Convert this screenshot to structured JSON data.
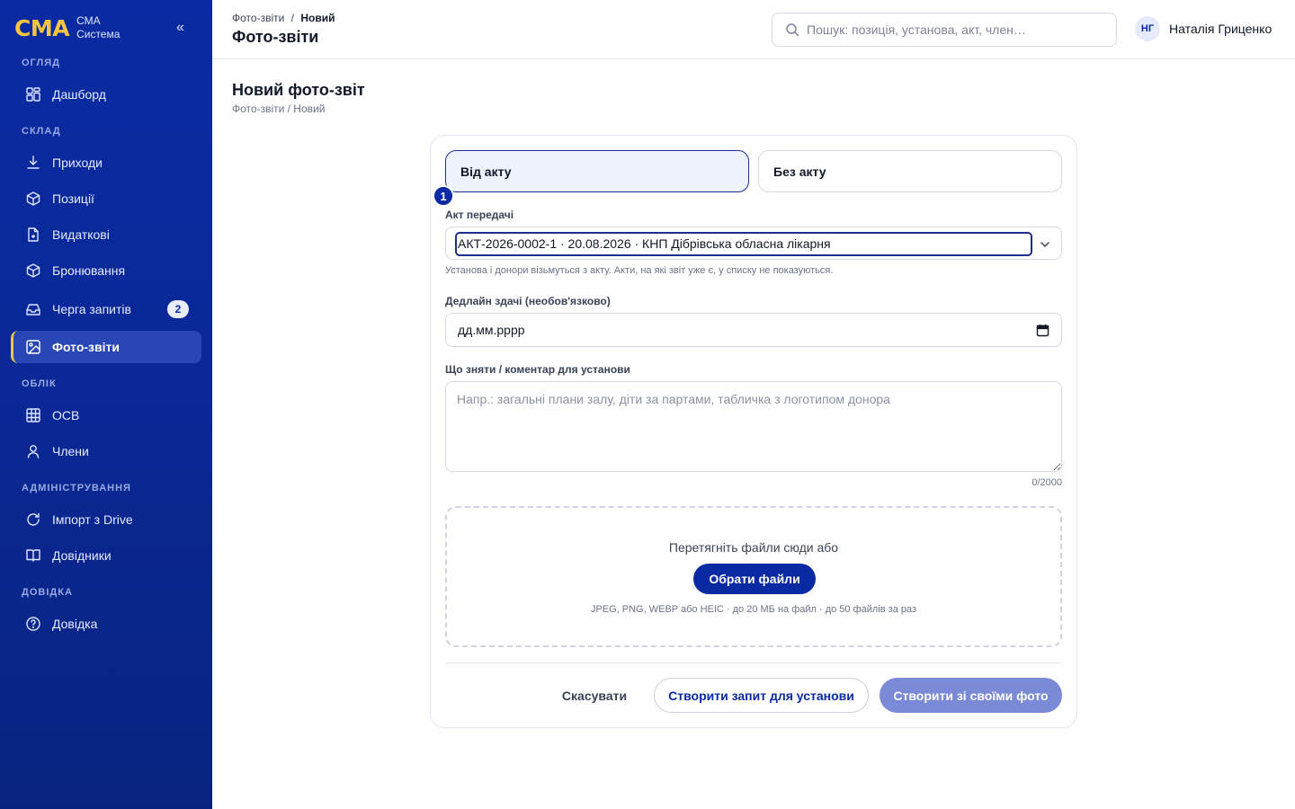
{
  "brand": {
    "logo": "СМА",
    "line1": "СМА",
    "line2": "Система",
    "collapse": "«"
  },
  "sidebar": {
    "sections": [
      {
        "title": "ОГЛЯД",
        "items": [
          {
            "label": "Дашборд",
            "icon": "dashboard-icon"
          }
        ]
      },
      {
        "title": "СКЛАД",
        "items": [
          {
            "label": "Приходи",
            "icon": "download-icon"
          },
          {
            "label": "Позиції",
            "icon": "box-icon"
          },
          {
            "label": "Видаткові",
            "icon": "file-icon"
          },
          {
            "label": "Бронювання",
            "icon": "box-icon"
          },
          {
            "label": "Черга запитів",
            "icon": "inbox-icon",
            "badge": "2"
          },
          {
            "label": "Фото-звіти",
            "icon": "image-icon",
            "active": true
          }
        ]
      },
      {
        "title": "ОБЛІК",
        "items": [
          {
            "label": "ОСВ",
            "icon": "table-icon"
          },
          {
            "label": "Члени",
            "icon": "user-icon"
          }
        ]
      },
      {
        "title": "АДМІНІСТРУВАННЯ",
        "items": [
          {
            "label": "Імпорт з Drive",
            "icon": "refresh-icon"
          },
          {
            "label": "Довідники",
            "icon": "book-icon"
          }
        ]
      },
      {
        "title": "ДОВІДКА",
        "items": [
          {
            "label": "Довідка",
            "icon": "help-icon"
          }
        ]
      }
    ]
  },
  "header": {
    "crumb_parent": "Фото-звіти",
    "crumb_sep": "/",
    "crumb_current": "Новий",
    "title": "Фото-звіти",
    "search_placeholder": "Пошук: позиція, установа, акт, член…",
    "user_initials": "НГ",
    "user_name": "Наталія Гриценко"
  },
  "content": {
    "title": "Новий фото-звіт",
    "crumbs": "Фото-звіти / Новий"
  },
  "form": {
    "tab_with_act": "Від акту",
    "tab_without_act": "Без акту",
    "step": "1",
    "act_label": "Акт передачі",
    "act_value": "АКТ-2026-0002-1 · 20.08.2026 · КНП Дібрівська обласна лікарня",
    "act_hint": "Установа і донори візьмуться з акту. Акти, на які звіт уже є, у списку не показуються.",
    "deadline_label": "Дедлайн здачі (необов'язково)",
    "deadline_placeholder": "дд.мм.рррр",
    "comment_label": "Що зняти / коментар для установи",
    "comment_placeholder": "Напр.: загальні плани залу, діти за партами, табличка з логотипом донора",
    "counter": "0/2000",
    "drop_text": "Перетягніть файли сюди або",
    "pick_button": "Обрати файли",
    "drop_hint": "JPEG, PNG, WEBP або HEIC · до 20 МБ на файл · до 50 файлів за раз",
    "cancel": "Скасувати",
    "request": "Створити запит для установи",
    "create": "Створити зі своїми фото"
  },
  "colors": {
    "sidebar": "#0a2aa3",
    "accent": "#f4c542",
    "primary": "#0a2aa3",
    "disabled_primary": "#7a8ad6"
  }
}
